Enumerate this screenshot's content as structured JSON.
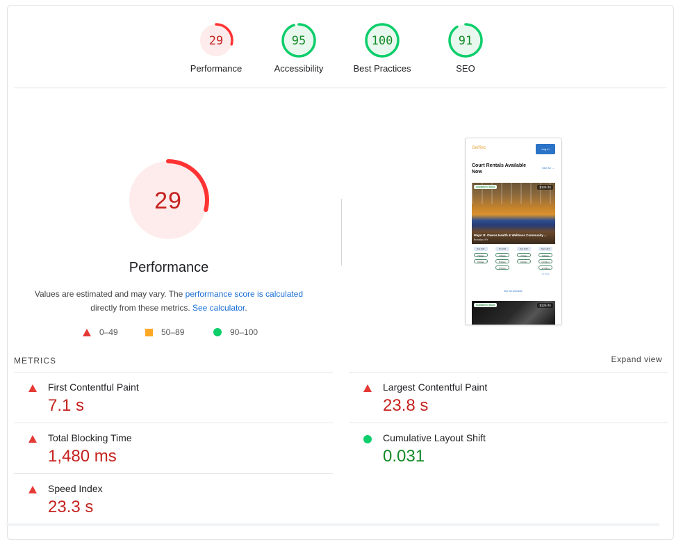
{
  "colors": {
    "fail": "#ff3333",
    "fail_bg": "#fdeceb",
    "average": "#ffa726",
    "pass": "#0cce6b",
    "pass_bg": "#e9f8ee",
    "fail_text": "#c5221f",
    "pass_text": "#138a27",
    "link": "#1a6fd6"
  },
  "gauges": [
    {
      "label": "Performance",
      "score": "29",
      "value": 29,
      "status": "fail"
    },
    {
      "label": "Accessibility",
      "score": "95",
      "value": 95,
      "status": "pass"
    },
    {
      "label": "Best Practices",
      "score": "100",
      "value": 100,
      "status": "pass"
    },
    {
      "label": "SEO",
      "score": "91",
      "value": 91,
      "status": "pass"
    }
  ],
  "performance": {
    "score": "29",
    "value": 29,
    "title": "Performance",
    "desc_prefix": "Values are estimated and may vary. The ",
    "desc_link": "performance score is calculated",
    "desc_mid": " directly from these metrics. ",
    "desc_link2": "See calculator",
    "desc_suffix": "."
  },
  "legend": [
    {
      "icon": "triangle-icon",
      "range": "0–49"
    },
    {
      "icon": "square-icon",
      "range": "50–89"
    },
    {
      "icon": "circle-icon",
      "range": "90–100"
    }
  ],
  "screenshot": {
    "logo": "GetRec",
    "login": "Log In",
    "heading": "Court Rentals Available Now",
    "see_all": "See All →",
    "badge": "Available to Book",
    "price": "$125 /hr",
    "venue": "Major R. Owens Health & Wellness Community ...",
    "location": "Brooklyn, NY",
    "days": [
      {
        "day": "Sat 1/21",
        "slots": [
          "7:00am",
          "8:00am"
        ]
      },
      {
        "day": "Fri 1/22",
        "slots": [
          "7:00am",
          "8:00am",
          "9:00pm"
        ]
      },
      {
        "day": "Sat 1/23",
        "slots": [
          "7:00am",
          "9:00pm"
        ]
      },
      {
        "day": "Sun 1/24",
        "slots": [
          "9:00pm",
          "10:00pm",
          "11:00pm",
          "+1 more"
        ]
      }
    ],
    "see_full": "See full schedule",
    "badge2": "Available to Book",
    "price2": "$125 /hr"
  },
  "metrics_section": {
    "header": "METRICS",
    "expand": "Expand view"
  },
  "metrics": [
    {
      "label": "First Contentful Paint",
      "value": "7.1 s",
      "status": "fail"
    },
    {
      "label": "Largest Contentful Paint",
      "value": "23.8 s",
      "status": "fail"
    },
    {
      "label": "Total Blocking Time",
      "value": "1,480 ms",
      "status": "fail"
    },
    {
      "label": "Cumulative Layout Shift",
      "value": "0.031",
      "status": "pass"
    },
    {
      "label": "Speed Index",
      "value": "23.3 s",
      "status": "fail"
    }
  ]
}
